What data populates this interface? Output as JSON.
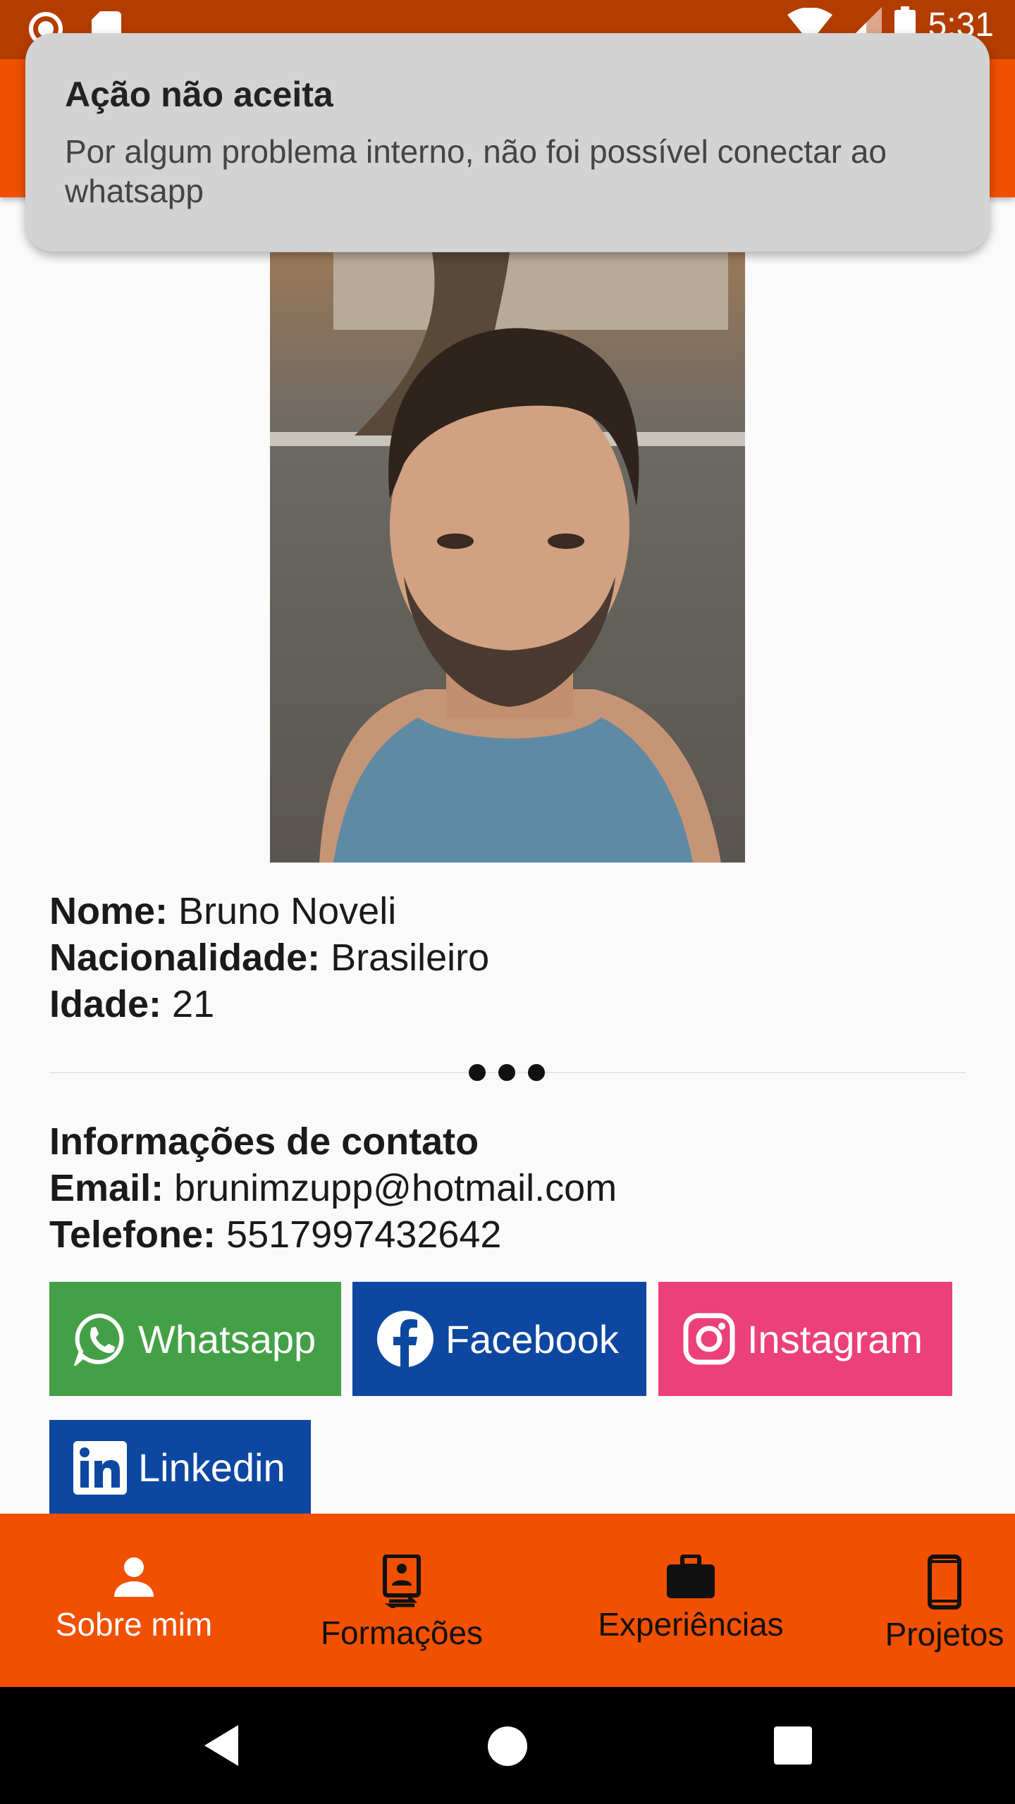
{
  "status_bar": {
    "time": "5:31"
  },
  "toast": {
    "title": "Ação não aceita",
    "message": "Por algum problema interno, não foi possível conectar ao whatsapp"
  },
  "profile": {
    "name_label": "Nome:",
    "name_value": "Bruno Noveli",
    "nationality_label": "Nacionalidade:",
    "nationality_value": "Brasileiro",
    "age_label": "Idade:",
    "age_value": "21"
  },
  "contact": {
    "heading": "Informações de contato",
    "email_label": "Email:",
    "email_value": "brunimzupp@hotmail.com",
    "phone_label": "Telefone:",
    "phone_value": "5517997432642"
  },
  "social_buttons": {
    "whatsapp": "Whatsapp",
    "facebook": "Facebook",
    "instagram": "Instagram",
    "linkedin": "Linkedin"
  },
  "colors": {
    "primary": "#f05000",
    "status_bar": "#b33d00",
    "whatsapp": "#43a047",
    "facebook": "#0d47a1",
    "instagram": "#ec407a",
    "linkedin": "#0d47a1"
  },
  "bottom_nav": {
    "items": [
      {
        "label": "Sobre mim",
        "icon": "person-icon",
        "active": true
      },
      {
        "label": "Formações",
        "icon": "badge-icon",
        "active": false
      },
      {
        "label": "Experiências",
        "icon": "briefcase-icon",
        "active": false
      },
      {
        "label": "Projetos",
        "icon": "phone-icon",
        "active": false
      }
    ]
  }
}
